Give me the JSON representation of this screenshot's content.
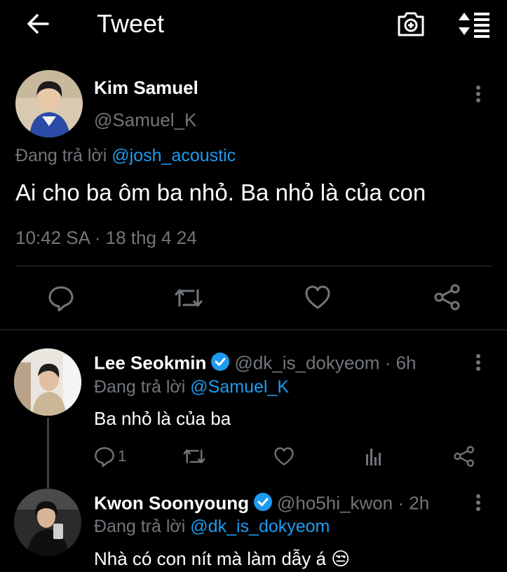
{
  "header": {
    "title": "Tweet"
  },
  "main_tweet": {
    "name": "Kim Samuel",
    "handle": "@Samuel_K",
    "reply_prefix": "Đang trả lời",
    "reply_to": "@josh_acoustic",
    "text": "Ai cho ba ôm ba nhỏ. Ba nhỏ là của con",
    "timestamp": "10:42 SA · 18 thg 4 24"
  },
  "replies": [
    {
      "name": "Lee Seokmin",
      "handle": "@dk_is_dokyeom",
      "time": " · 6h",
      "reply_prefix": "Đang trả lời",
      "reply_to": "@Samuel_K",
      "text": "Ba nhỏ là của ba",
      "reply_count": "1"
    },
    {
      "name": "Kwon Soonyoung",
      "handle": "@ho5hi_kwon",
      "time": " · 2h",
      "reply_prefix": "Đang trả lời",
      "reply_to": "@dk_is_dokyeom",
      "text": "Nhà có con nít mà làm dẫy á 😒"
    }
  ],
  "icons": {
    "back": "arrow-left-icon",
    "camera": "camera-plus-icon",
    "sort": "sort-icon",
    "more": "more-vertical-icon",
    "reply": "comment-icon",
    "retweet": "retweet-icon",
    "like": "heart-icon",
    "share": "share-icon",
    "analytics": "analytics-icon",
    "verified": "verified-badge-icon"
  },
  "colors": {
    "accent": "#1d9bf0",
    "muted": "#71767b",
    "background": "#000000"
  }
}
